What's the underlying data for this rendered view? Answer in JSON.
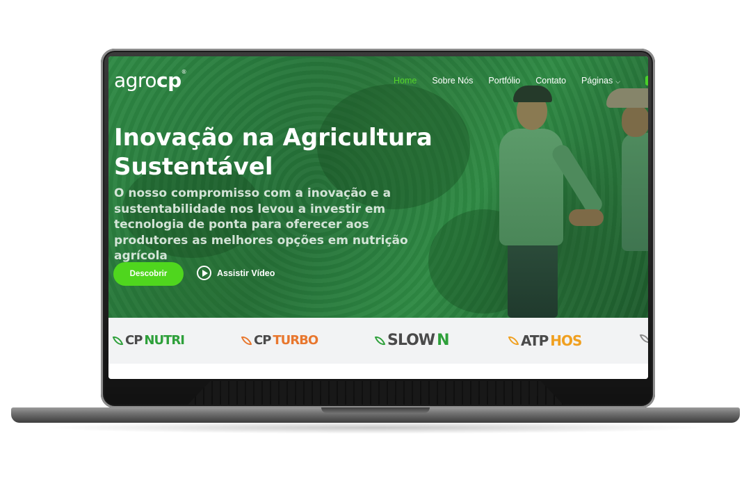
{
  "nav": {
    "logo_light": "agro",
    "logo_bold": "cp",
    "logo_mark": "®",
    "items": [
      {
        "label": "Home",
        "active": true
      },
      {
        "label": "Sobre Nós",
        "active": false
      },
      {
        "label": "Portfólio",
        "active": false
      },
      {
        "label": "Contato",
        "active": false
      },
      {
        "label": "Páginas",
        "active": false,
        "icon": "chevron-down-icon"
      }
    ]
  },
  "hero": {
    "title_line1": "Inovação na Agricultura",
    "title_line2": "Sustentável",
    "description": "O nosso compromisso com a inovação e a sustentabilidade nos levou a investir em tecnologia de ponta para oferecer aos produtores as melhores opções em nutrição agrícola",
    "primary_button": "Descobrir",
    "video_link": "Assistir Vídeo",
    "video_icon": "play-circle-icon"
  },
  "brands": [
    {
      "prefix": "CP",
      "suffix": "NUTRI",
      "color": "#2ea03a"
    },
    {
      "prefix": "CP",
      "suffix": "TURBO",
      "color": "#e8772e"
    },
    {
      "prefix": "SLOW",
      "suffix": "N",
      "color": "#2ea03a"
    },
    {
      "prefix": "ATP",
      "suffix": "HOS",
      "color": "#f0a020"
    }
  ],
  "colors": {
    "accent": "#4fd61e",
    "hero_overlay": "#2f8a45",
    "brand_strip_bg": "#f2f3f4"
  }
}
